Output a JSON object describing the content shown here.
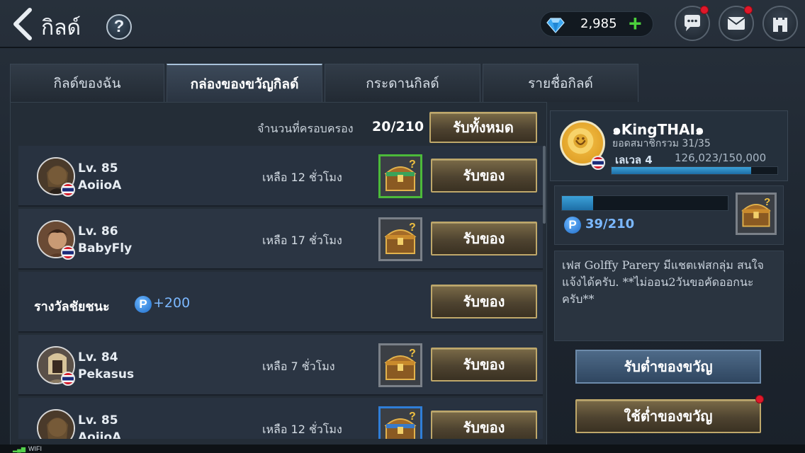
{
  "header": {
    "title": "กิลด์",
    "help_label": "?",
    "gems": "2,985",
    "gem_plus": "+"
  },
  "tabs": [
    {
      "label": "กิลด์ของฉัน"
    },
    {
      "label": "กล่องของขวัญกิลด์"
    },
    {
      "label": "กระดานกิลด์"
    },
    {
      "label": "รายชื่อกิลด์"
    }
  ],
  "gift_list": {
    "owned_label": "จำนวนที่ครอบครอง",
    "owned_value": "20/210",
    "claim_all": "รับทั้งหมด",
    "rows": [
      {
        "level": "Lv. 85",
        "name": "AoiioA",
        "remaining": "เหลือ 12 ชั่วโมง",
        "claim": "รับของ",
        "chest_frame": "green"
      },
      {
        "level": "Lv. 86",
        "name": "BabyFly",
        "remaining": "เหลือ 17 ชั่วโมง",
        "claim": "รับของ",
        "chest_frame": "gray"
      },
      {
        "level": "Lv. 84",
        "name": "Pekasus",
        "remaining": "เหลือ 7 ชั่วโมง",
        "claim": "รับของ",
        "chest_frame": "gray"
      },
      {
        "level": "Lv. 85",
        "name": "AoiioA",
        "remaining": "เหลือ 12 ชั่วโมง",
        "claim": "รับของ",
        "chest_frame": "blue"
      }
    ],
    "victory": {
      "label": "รางวัลชัยชนะ",
      "p_icon": "P",
      "points": "+200",
      "claim": "รับของ"
    }
  },
  "guild": {
    "name": "๑KingTHAI๑",
    "members": "ยอดสมาชิกรวม 31/35",
    "level": "เลเวล 4",
    "exp": "126,023/150,000",
    "exp_fraction": 0.84,
    "gift_points": "39/210",
    "gift_fraction": 0.19,
    "p_icon": "P",
    "notice": "เฟส Golffy Parery มีแชตเฟสกลุ่ม สนใจแจ้งได้ครับ. **ไม่ออน2วันขอคัดออกนะครับ**",
    "request_gift": "รับต่ำของขวัญ",
    "use_gift": "ใช้ต่ำของขวัญ"
  },
  "status": {
    "wifi": "WIFI"
  },
  "colors": {
    "gold_border": "#bfa86a",
    "accent_blue": "#7bb8ff",
    "notify_red": "#e0182a",
    "plus_green": "#4cd13c"
  }
}
